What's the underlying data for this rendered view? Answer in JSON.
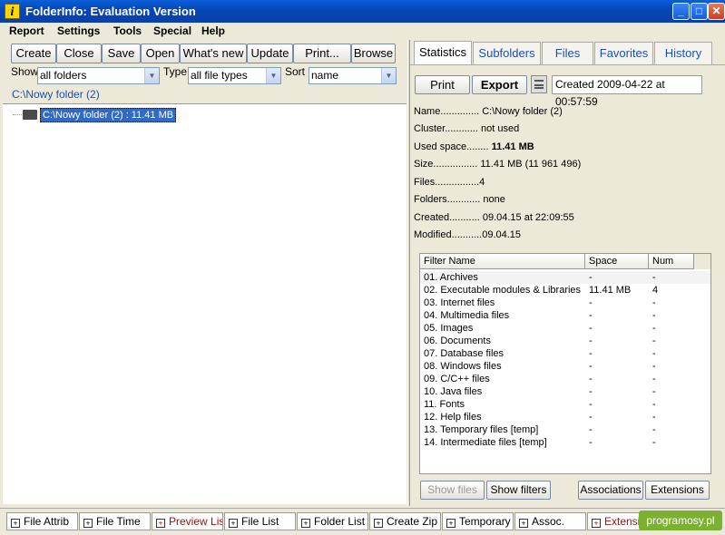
{
  "window": {
    "title": "FolderInfo: Evaluation Version"
  },
  "menu": [
    "Report",
    "Settings",
    "Tools",
    "Special",
    "Help"
  ],
  "toolbar": [
    "Create",
    "Close",
    "Save",
    "Open",
    "What's new",
    "Update",
    "Print...",
    "Browse"
  ],
  "filters": {
    "show_label": "Show",
    "show_value": "all folders",
    "type_label": "Type",
    "type_value": "all file types",
    "sort_label": "Sort",
    "sort_value": "name"
  },
  "path": "C:\\Nowy folder (2)",
  "tree": {
    "node": "C:\\Nowy folder (2) : 11.41 MB"
  },
  "tabs": [
    "Statistics",
    "Subfolders",
    "Files",
    "Favorites",
    "History"
  ],
  "actions": {
    "print": "Print",
    "export": "Export",
    "created": "Created 2009-04-22 at 00:57:59"
  },
  "info": [
    {
      "label": "Name..............",
      "value": "C:\\Nowy folder (2)",
      "bold": false
    },
    {
      "label": "Cluster............",
      "value": "not used",
      "bold": false
    },
    {
      "label": "Used space........",
      "value": "11.41 MB",
      "bold": true
    },
    {
      "label": "Size................",
      "value": "11.41 MB (11 961 496)",
      "bold": false
    },
    {
      "label": "Files................",
      "value": "4",
      "bold": false
    },
    {
      "label": "Folders............",
      "value": "none",
      "bold": false
    },
    {
      "label": "Created...........",
      "value": "09.04.15 at 22:09:55",
      "bold": false
    },
    {
      "label": "Modified...........",
      "value": "09.04.15",
      "bold": false
    }
  ],
  "filter_table": {
    "columns": [
      "Filter Name",
      "Space",
      "Num"
    ],
    "rows": [
      [
        "01. Archives",
        "-",
        "-"
      ],
      [
        "02. Executable modules & Libraries",
        "11.41 MB",
        "4"
      ],
      [
        "03. Internet files",
        "-",
        "-"
      ],
      [
        "04. Multimedia files",
        "-",
        "-"
      ],
      [
        "05. Images",
        "-",
        "-"
      ],
      [
        "06. Documents",
        "-",
        "-"
      ],
      [
        "07. Database files",
        "-",
        "-"
      ],
      [
        "08. Windows files",
        "-",
        "-"
      ],
      [
        "09. C/C++ files",
        "-",
        "-"
      ],
      [
        "10. Java files",
        "-",
        "-"
      ],
      [
        "11. Fonts",
        "-",
        "-"
      ],
      [
        "12. Help files",
        "-",
        "-"
      ],
      [
        "13. Temporary files [temp]",
        "-",
        "-"
      ],
      [
        "14. Intermediate files [temp]",
        "-",
        "-"
      ]
    ]
  },
  "bottom_buttons": {
    "show_files": "Show files",
    "show_filters": "Show filters",
    "associations": "Associations",
    "extensions": "Extensions"
  },
  "status_buttons": [
    "File Attrib",
    "File Time",
    "Preview List",
    "File List",
    "Folder List",
    "Create Zip",
    "Temporary",
    "Assoc.",
    "Extensio"
  ],
  "watermark": "programosy.pl",
  "colors": {
    "title": "#0a4fc8",
    "selection": "#316ac5",
    "link": "#1d4fb3",
    "red_text": "#a01010"
  }
}
